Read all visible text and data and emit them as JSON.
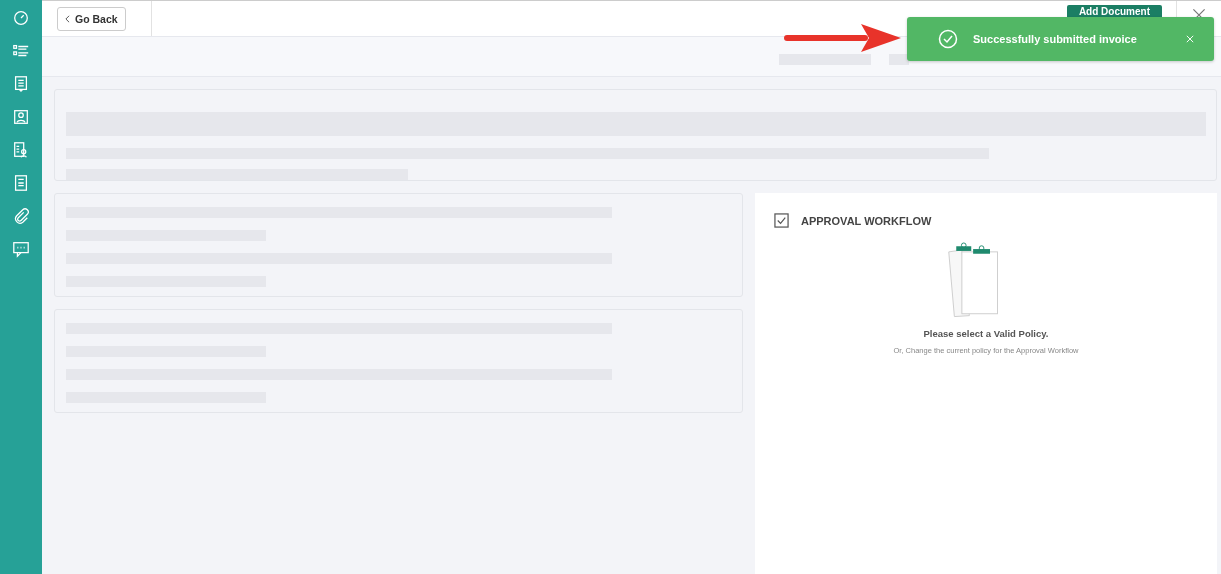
{
  "top_bar": {
    "back_button": "Go Back",
    "add_button": "Add Document"
  },
  "toast": {
    "message": "Successfully submitted invoice"
  },
  "approval_panel": {
    "title": "APPROVAL WORKFLOW",
    "message": "Please select a Valid Policy.",
    "hint": "Or, Change the current policy for the Approval Workflow"
  }
}
